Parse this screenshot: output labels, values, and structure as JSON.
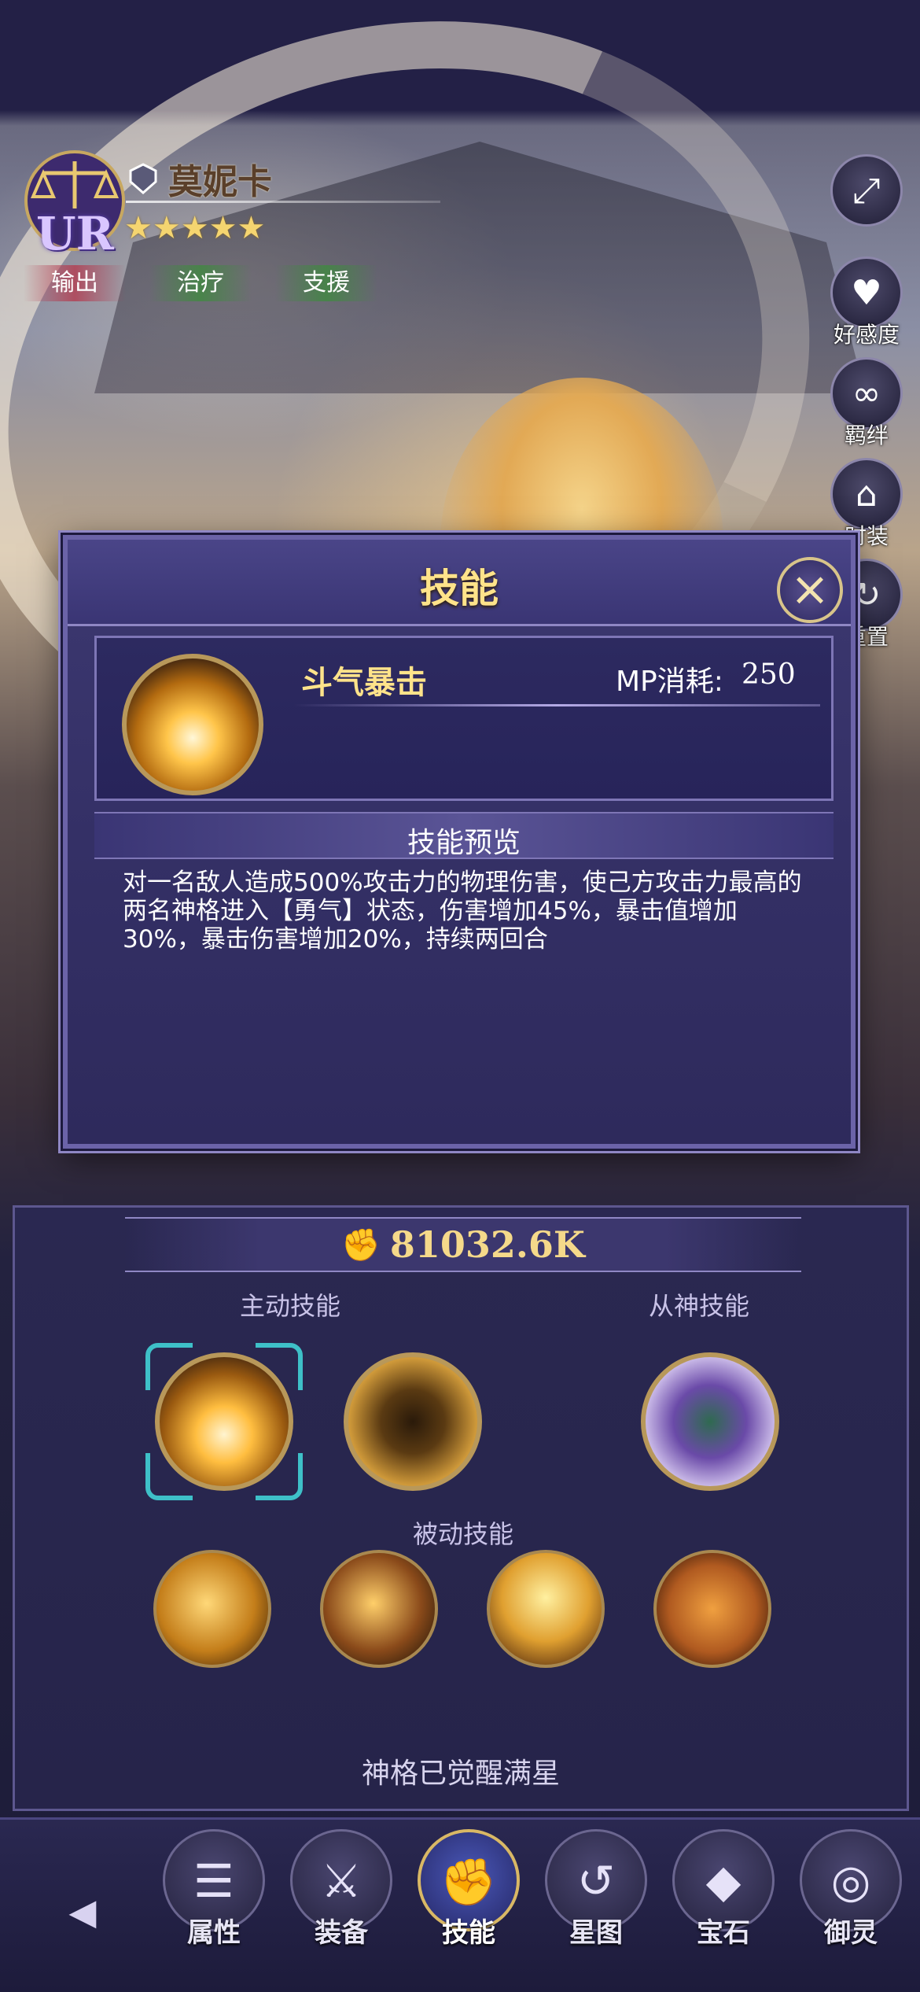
{
  "hero": {
    "rarity": "UR",
    "name": "莫妮卡",
    "stars": "★★★★★",
    "tags": [
      "输出",
      "治疗",
      "支援"
    ]
  },
  "side_buttons": [
    {
      "label": "",
      "icon": "expand-icon"
    },
    {
      "label": "好感度",
      "icon": "heart-icon"
    },
    {
      "label": "羁绊",
      "icon": "link-icon"
    },
    {
      "label": "时装",
      "icon": "hanger-icon"
    },
    {
      "label": "重置",
      "icon": "reset-icon"
    }
  ],
  "modal": {
    "title": "技能",
    "skill_name": "斗气暴击",
    "mp_label": "MP消耗:",
    "mp_value": "250",
    "preview_title": "技能预览",
    "description": "对一名敌人造成500%攻击力的物理伤害，使己方攻击力最高的两名神格进入【勇气】状态，伤害增加45%，暴击值增加30%，暴击伤害增加20%，持续两回合"
  },
  "panel": {
    "power": "81032.6K",
    "active_label": "主动技能",
    "deity_label": "从神技能",
    "passive_label": "被动技能",
    "awaken_text": "神格已觉醒满星"
  },
  "nav": {
    "items": [
      {
        "label": "属性",
        "icon": "list-icon"
      },
      {
        "label": "装备",
        "icon": "sword-icon"
      },
      {
        "label": "技能",
        "icon": "fist-icon"
      },
      {
        "label": "星图",
        "icon": "swirl-icon"
      },
      {
        "label": "宝石",
        "icon": "gem-icon"
      },
      {
        "label": "御灵",
        "icon": "spirit-icon"
      }
    ]
  }
}
